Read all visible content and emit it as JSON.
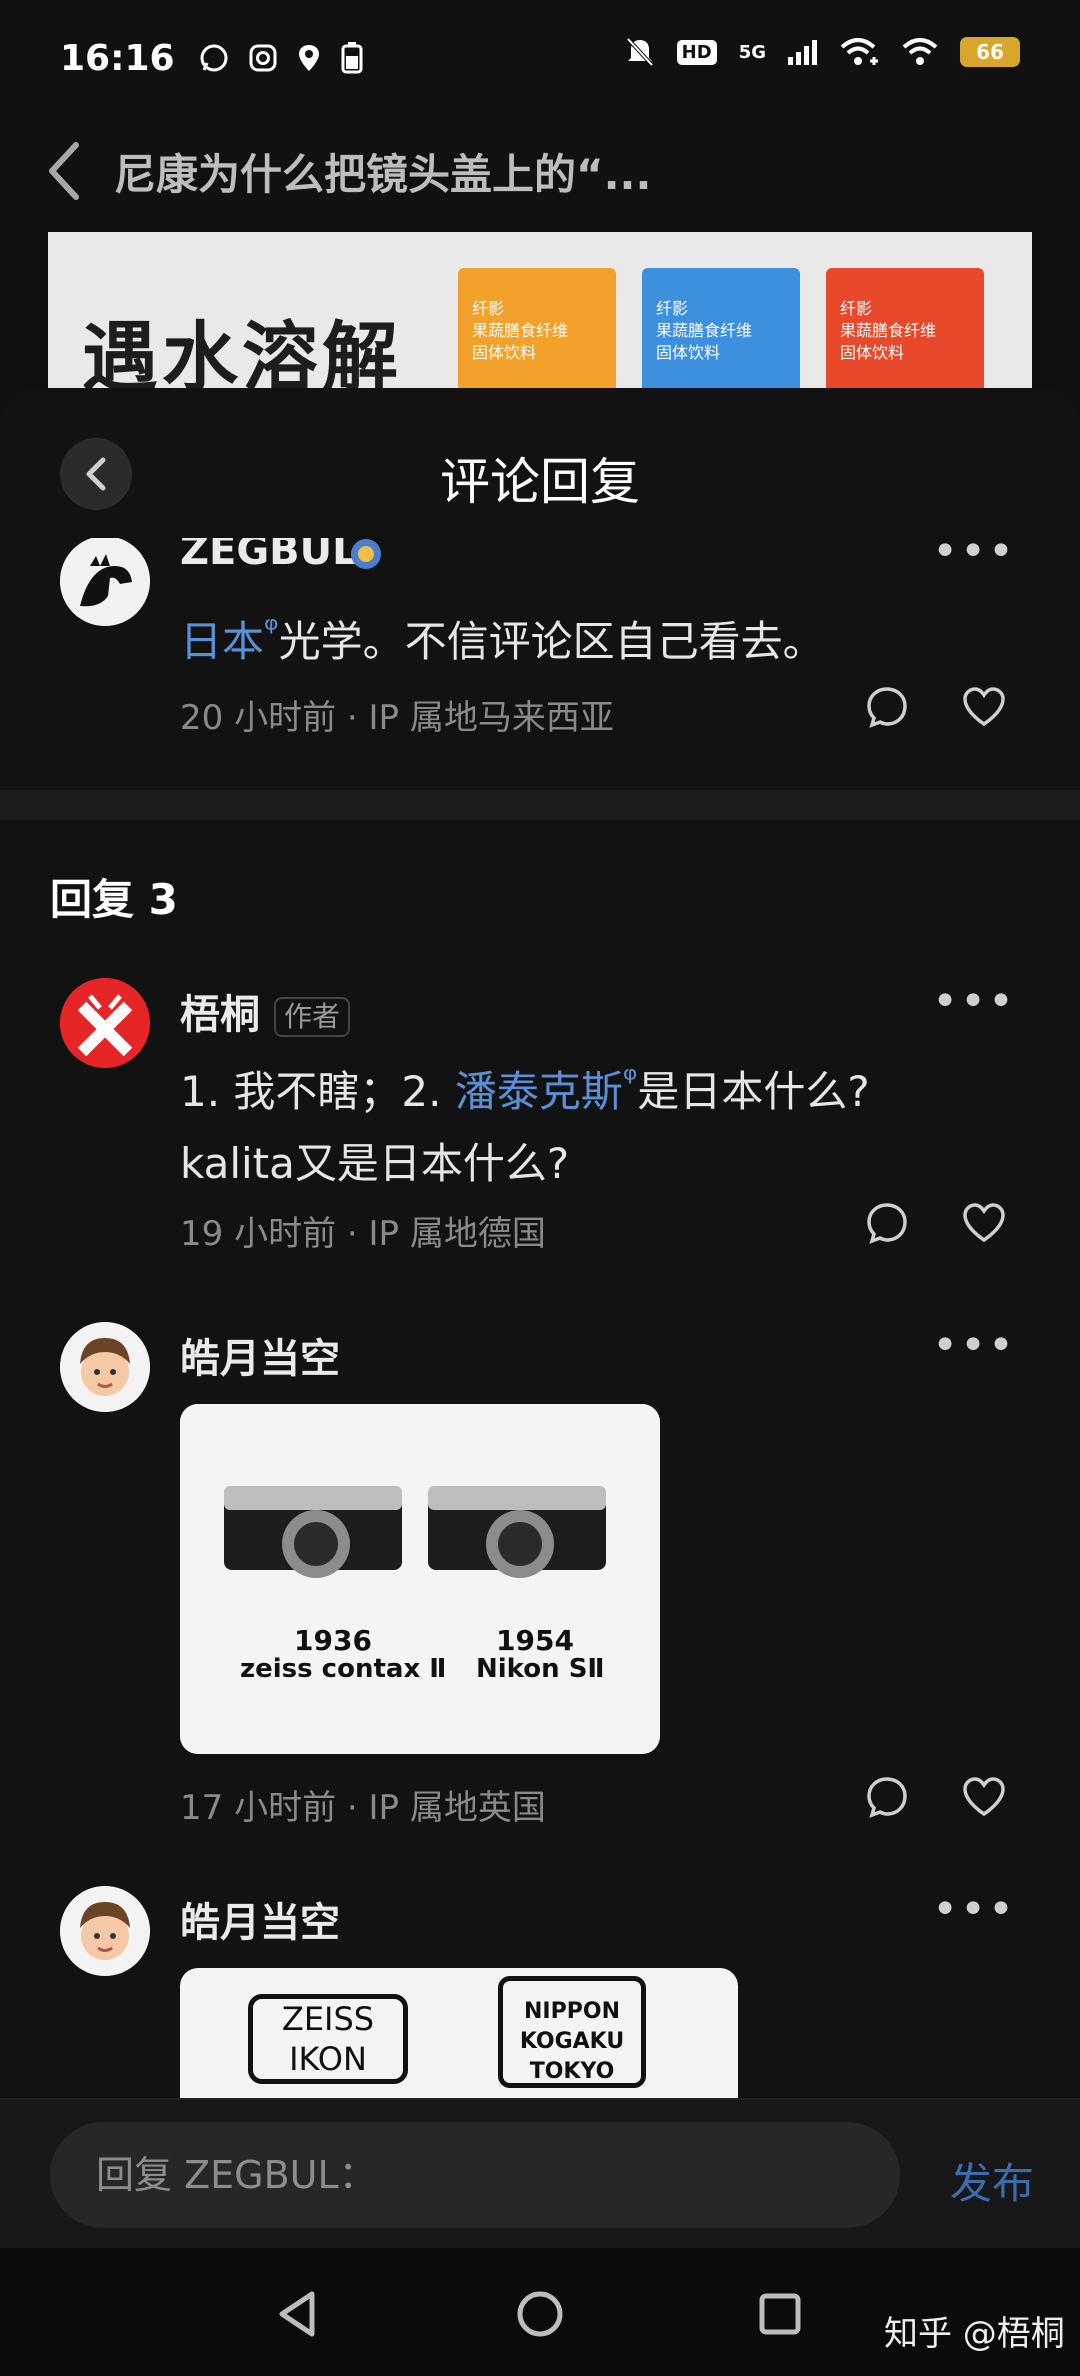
{
  "status_bar": {
    "time": "16:16",
    "hd": "HD",
    "network": "5G",
    "battery": "66",
    "battery_color": "#d9a52a"
  },
  "article": {
    "title": "尼康为什么把镜头盖上的“..."
  },
  "ad": {
    "headline": "遇水溶解",
    "box_label": "纤影\n果蔬膳食纤维\n固体饮料",
    "box_colors": [
      "#f2a12a",
      "#3d8fe0",
      "#e8492b"
    ]
  },
  "sheet": {
    "title": "评论回复"
  },
  "parent_comment": {
    "user": "ZEGBUL",
    "text_link": "日本",
    "text_rest": "光学。不信评论区自己看去。",
    "meta": "20 小时前 · IP 属地马来西亚"
  },
  "replies_heading": "回复 3",
  "replies": [
    {
      "user": "梧桐",
      "tag": "作者",
      "text_a": "1. 我不瞎；2. ",
      "text_link": "潘泰克斯",
      "text_b": "是日本什么?",
      "text_line2": "kalita又是日本什么?",
      "meta": "19 小时前 · IP 属地德国"
    },
    {
      "user": "皓月当空",
      "photo": {
        "left_year": "1936",
        "left_model": "zeiss contax Ⅱ",
        "right_year": "1954",
        "right_model": "Nikon SⅡ"
      },
      "meta": "17 小时前 · IP 属地英国"
    },
    {
      "user": "皓月当空",
      "photo": {
        "logo_left_1": "ZEISS",
        "logo_left_2": "IKON",
        "logo_right_1": "NIPPON",
        "logo_right_2": "KOGAKU",
        "logo_right_3": "TOKYO"
      }
    }
  ],
  "input": {
    "placeholder": "回复 ZEGBUL：",
    "publish_label": "发布"
  },
  "watermark": "知乎 @梧桐",
  "icons": [
    "back-chevron-icon",
    "more-icon",
    "reply-icon",
    "like-icon",
    "nav-back-icon",
    "nav-home-icon",
    "nav-recents-icon"
  ]
}
